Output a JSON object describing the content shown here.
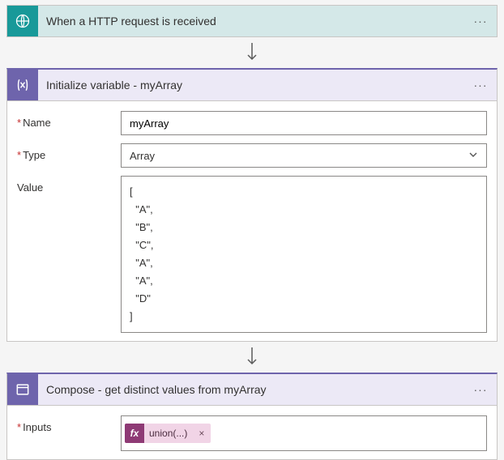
{
  "trigger": {
    "title": "When a HTTP request is received"
  },
  "variable": {
    "title": "Initialize variable - myArray",
    "name_label": "Name",
    "name_value": "myArray",
    "type_label": "Type",
    "type_value": "Array",
    "value_label": "Value",
    "value_content": "[\n  \"A\",\n  \"B\",\n  \"C\",\n  \"A\",\n  \"A\",\n  \"D\"\n]"
  },
  "compose": {
    "title": "Compose - get distinct values from myArray",
    "inputs_label": "Inputs",
    "token_prefix": "fx",
    "token_text": "union(...)",
    "token_close": "×"
  },
  "menu_dots": "···"
}
